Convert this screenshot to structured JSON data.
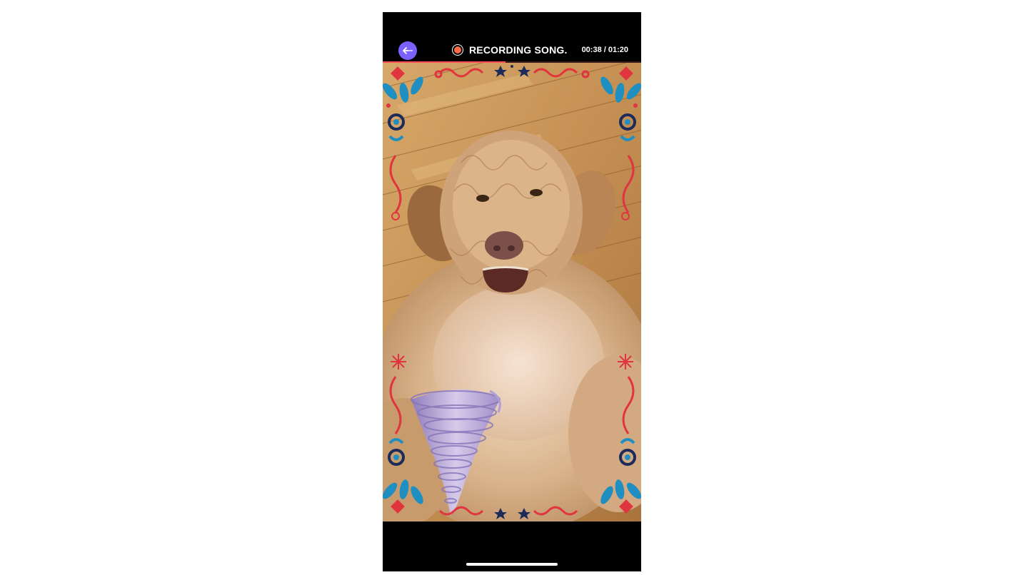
{
  "header": {
    "back_icon": "back-arrow-icon",
    "record_icon": "record-dot-icon",
    "status_label": "RECORDING SONG.",
    "timer": "00:38 / 01:20",
    "progress_fraction": 0.475
  },
  "colors": {
    "accent": "#7b61ff",
    "record": "#ff6a4a",
    "progress": "#ff4d57",
    "frame_red": "#e0343f",
    "frame_blue": "#1f8fc2",
    "frame_navy": "#1d2b5a",
    "tornado": "#b8a6dc"
  },
  "scene": {
    "subject": "dog-photo",
    "overlay_frame": "folk-floral-frame",
    "sticker": "tornado-sticker"
  }
}
